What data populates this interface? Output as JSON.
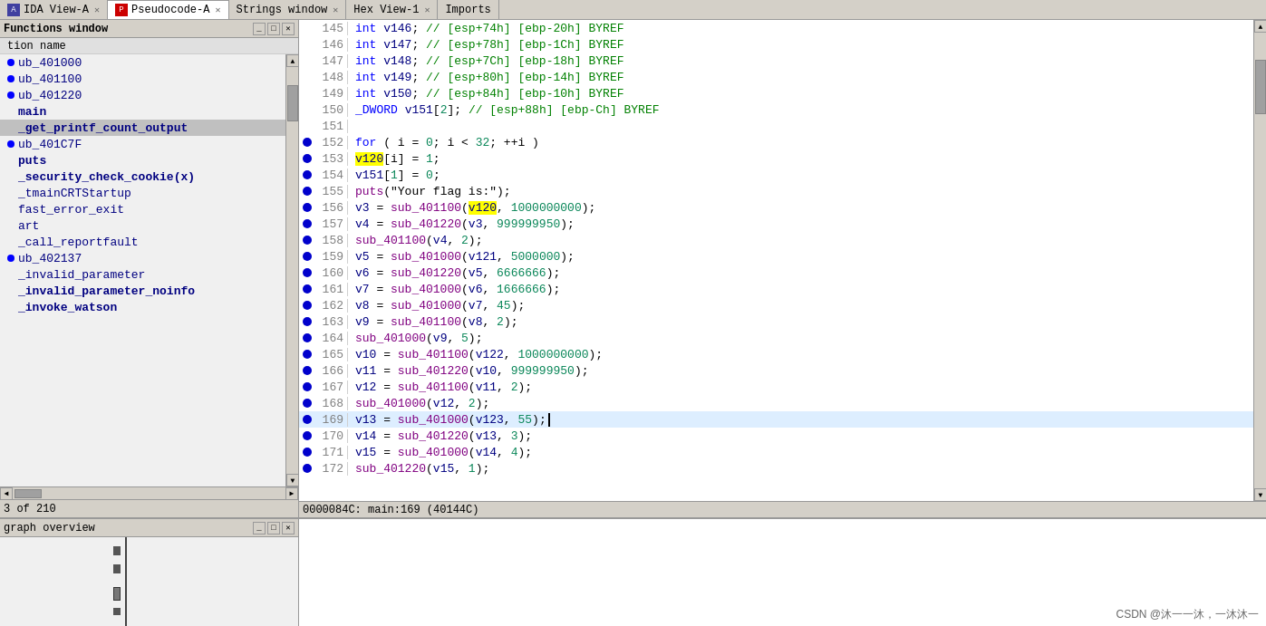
{
  "tabs": [
    {
      "id": "ida-view-a",
      "label": "IDA View-A",
      "active": false,
      "closeable": true,
      "icon": "ida"
    },
    {
      "id": "pseudocode-a",
      "label": "Pseudocode-A",
      "active": true,
      "closeable": true,
      "icon": "pseudo"
    },
    {
      "id": "strings-window",
      "label": "Strings window",
      "active": false,
      "closeable": true,
      "icon": "strings"
    },
    {
      "id": "hex-view-1",
      "label": "Hex View-1",
      "active": false,
      "closeable": true,
      "icon": "hex"
    },
    {
      "id": "imports",
      "label": "Imports",
      "active": false,
      "closeable": false,
      "icon": "imports"
    }
  ],
  "left_panel": {
    "title": "Functions window",
    "column_header": "tion name",
    "functions": [
      {
        "name": "ub_401000",
        "has_dot": true
      },
      {
        "name": "ub_401100",
        "has_dot": true
      },
      {
        "name": "ub_401220",
        "has_dot": true
      },
      {
        "name": "main",
        "has_dot": false,
        "bold": true
      },
      {
        "name": "_get_printf_count_output",
        "has_dot": false,
        "bold": true,
        "selected": true
      },
      {
        "name": "ub_401C7F",
        "has_dot": true
      },
      {
        "name": "puts",
        "has_dot": false,
        "bold": true
      },
      {
        "name": "_security_check_cookie(x)",
        "has_dot": false,
        "bold": true
      },
      {
        "name": "_tmainCRTStartup",
        "has_dot": false
      },
      {
        "name": "fast_error_exit",
        "has_dot": false
      },
      {
        "name": "art",
        "has_dot": false
      },
      {
        "name": "_call_reportfault",
        "has_dot": false
      },
      {
        "name": "ub_402137",
        "has_dot": true
      },
      {
        "name": "_invalid_parameter",
        "has_dot": false
      },
      {
        "name": "_invalid_parameter_noinfo",
        "has_dot": false,
        "bold": true
      },
      {
        "name": "_invoke_watson",
        "has_dot": false,
        "bold": true
      }
    ],
    "status": "3 of 210"
  },
  "code_lines": [
    {
      "num": 145,
      "has_dot": false,
      "content": "    int v146; // [esp+74h] [ebp-20h] BYREF"
    },
    {
      "num": 146,
      "has_dot": false,
      "content": "    int v147; // [esp+78h] [ebp-1Ch] BYREF"
    },
    {
      "num": 147,
      "has_dot": false,
      "content": "    int v148; // [esp+7Ch] [ebp-18h] BYREF"
    },
    {
      "num": 148,
      "has_dot": false,
      "content": "    int v149; // [esp+80h] [ebp-14h] BYREF"
    },
    {
      "num": 149,
      "has_dot": false,
      "content": "    int v150; // [esp+84h] [ebp-10h] BYREF"
    },
    {
      "num": 150,
      "has_dot": false,
      "content": "    _DWORD v151[2]; // [esp+88h] [ebp-Ch] BYREF"
    },
    {
      "num": 151,
      "has_dot": false,
      "content": ""
    },
    {
      "num": 152,
      "has_dot": true,
      "content": "    for ( i = 0; i < 32; ++i )"
    },
    {
      "num": 153,
      "has_dot": true,
      "content": "      v120[i] = 1;",
      "highlight_v120": true
    },
    {
      "num": 154,
      "has_dot": true,
      "content": "    v151[1] = 0;"
    },
    {
      "num": 155,
      "has_dot": true,
      "content": "    puts(\"Your flag is:\");"
    },
    {
      "num": 156,
      "has_dot": true,
      "content": "    v3 = sub_401100(v120, 1000000000);",
      "highlight_v120": true
    },
    {
      "num": 157,
      "has_dot": true,
      "content": "    v4 = sub_401220(v3, 999999950);"
    },
    {
      "num": 158,
      "has_dot": true,
      "content": "    sub_401100(v4, 2);"
    },
    {
      "num": 159,
      "has_dot": true,
      "content": "    v5 = sub_401000(v121, 5000000);"
    },
    {
      "num": 160,
      "has_dot": true,
      "content": "    v6 = sub_401220(v5, 6666666);"
    },
    {
      "num": 161,
      "has_dot": true,
      "content": "    v7 = sub_401000(v6, 1666666);"
    },
    {
      "num": 162,
      "has_dot": true,
      "content": "    v8 = sub_401000(v7, 45);"
    },
    {
      "num": 163,
      "has_dot": true,
      "content": "    v9 = sub_401100(v8, 2);"
    },
    {
      "num": 164,
      "has_dot": true,
      "content": "    sub_401000(v9, 5);"
    },
    {
      "num": 165,
      "has_dot": true,
      "content": "    v10 = sub_401100(v122, 1000000000);"
    },
    {
      "num": 166,
      "has_dot": true,
      "content": "    v11 = sub_401220(v10, 999999950);"
    },
    {
      "num": 167,
      "has_dot": true,
      "content": "    v12 = sub_401100(v11, 2);"
    },
    {
      "num": 168,
      "has_dot": true,
      "content": "    sub_401000(v12, 2);"
    },
    {
      "num": 169,
      "has_dot": true,
      "content": "    v13 = sub_401000(v123, 55);",
      "cursor": true
    },
    {
      "num": 170,
      "has_dot": true,
      "content": "    v14 = sub_401220(v13, 3);"
    },
    {
      "num": 171,
      "has_dot": true,
      "content": "    v15 = sub_401000(v14, 4);"
    },
    {
      "num": 172,
      "has_dot": true,
      "content": "    sub_401220(v15, 1);"
    }
  ],
  "bottom_status": "0000084C: main:169 (40144C)",
  "graph_overview": {
    "title": "graph overview"
  },
  "watermark": "CSDN @沐一一沐，一沐沐一"
}
